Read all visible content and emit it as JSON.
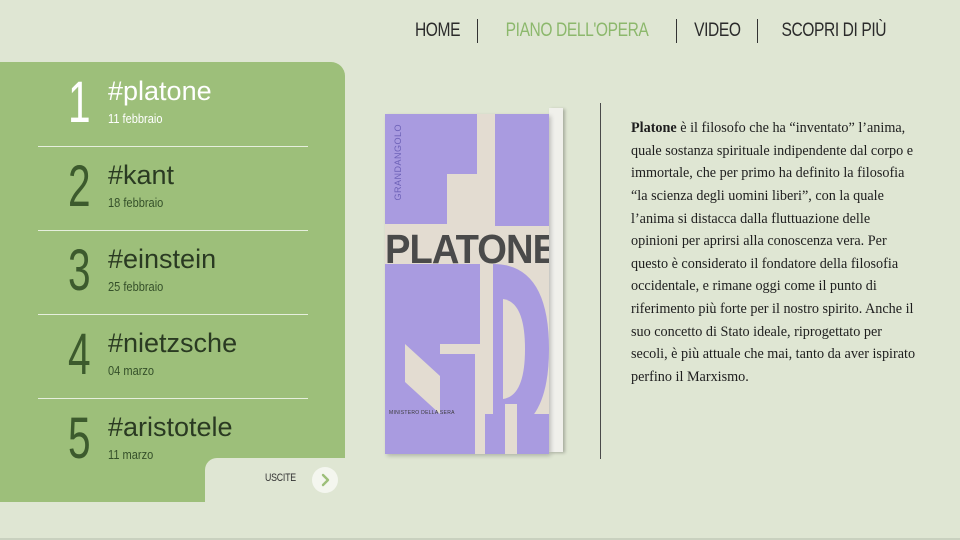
{
  "nav": {
    "items": [
      {
        "label": "HOME",
        "active": false
      },
      {
        "label": "PIANO DELL'OPERA",
        "active": true
      },
      {
        "label": "VIDEO",
        "active": false
      },
      {
        "label": "SCOPRI DI PIÙ",
        "active": false
      }
    ]
  },
  "sidebar": {
    "items": [
      {
        "number": "1",
        "tag": "#platone",
        "date": "11 febbraio",
        "selected": true
      },
      {
        "number": "2",
        "tag": "#kant",
        "date": "18 febbraio",
        "selected": false
      },
      {
        "number": "3",
        "tag": "#einstein",
        "date": "25 febbraio",
        "selected": false
      },
      {
        "number": "4",
        "tag": "#nietzsche",
        "date": "04 marzo",
        "selected": false
      },
      {
        "number": "5",
        "tag": "#aristotele",
        "date": "11 marzo",
        "selected": false
      }
    ],
    "uscite_label": "USCITE",
    "uscite_icon": "chevron-right-icon"
  },
  "book": {
    "series": "GRANDANGOLO",
    "title": "PLATONE",
    "publisher": "MINISTERO DELLA SERA"
  },
  "description": {
    "lead": "Platone",
    "body": " è il filosofo che ha “inventato” l’anima, quale sostanza spirituale indipendente dal corpo e immortale, che per primo ha definito la filosofia “la scienza degli uomini liberi”, con la quale l’anima si distacca dalla fluttuazione delle opinioni per aprirsi alla conoscenza vera. Per questo è considerato il fondatore della filosofia occidentale, e rimane oggi come il punto di riferimento più forte per il nostro spirito. Anche il suo concetto di Stato ideale, riprogettato per secoli, è più attuale che mai, tanto da aver ispirato perfino il Marxismo."
  },
  "colors": {
    "background": "#dfe6d3",
    "panel": "#9dbf7a",
    "active_nav": "#8cb86c",
    "cover_purple": "#a99be0",
    "cover_beige": "#e3dcd1"
  }
}
